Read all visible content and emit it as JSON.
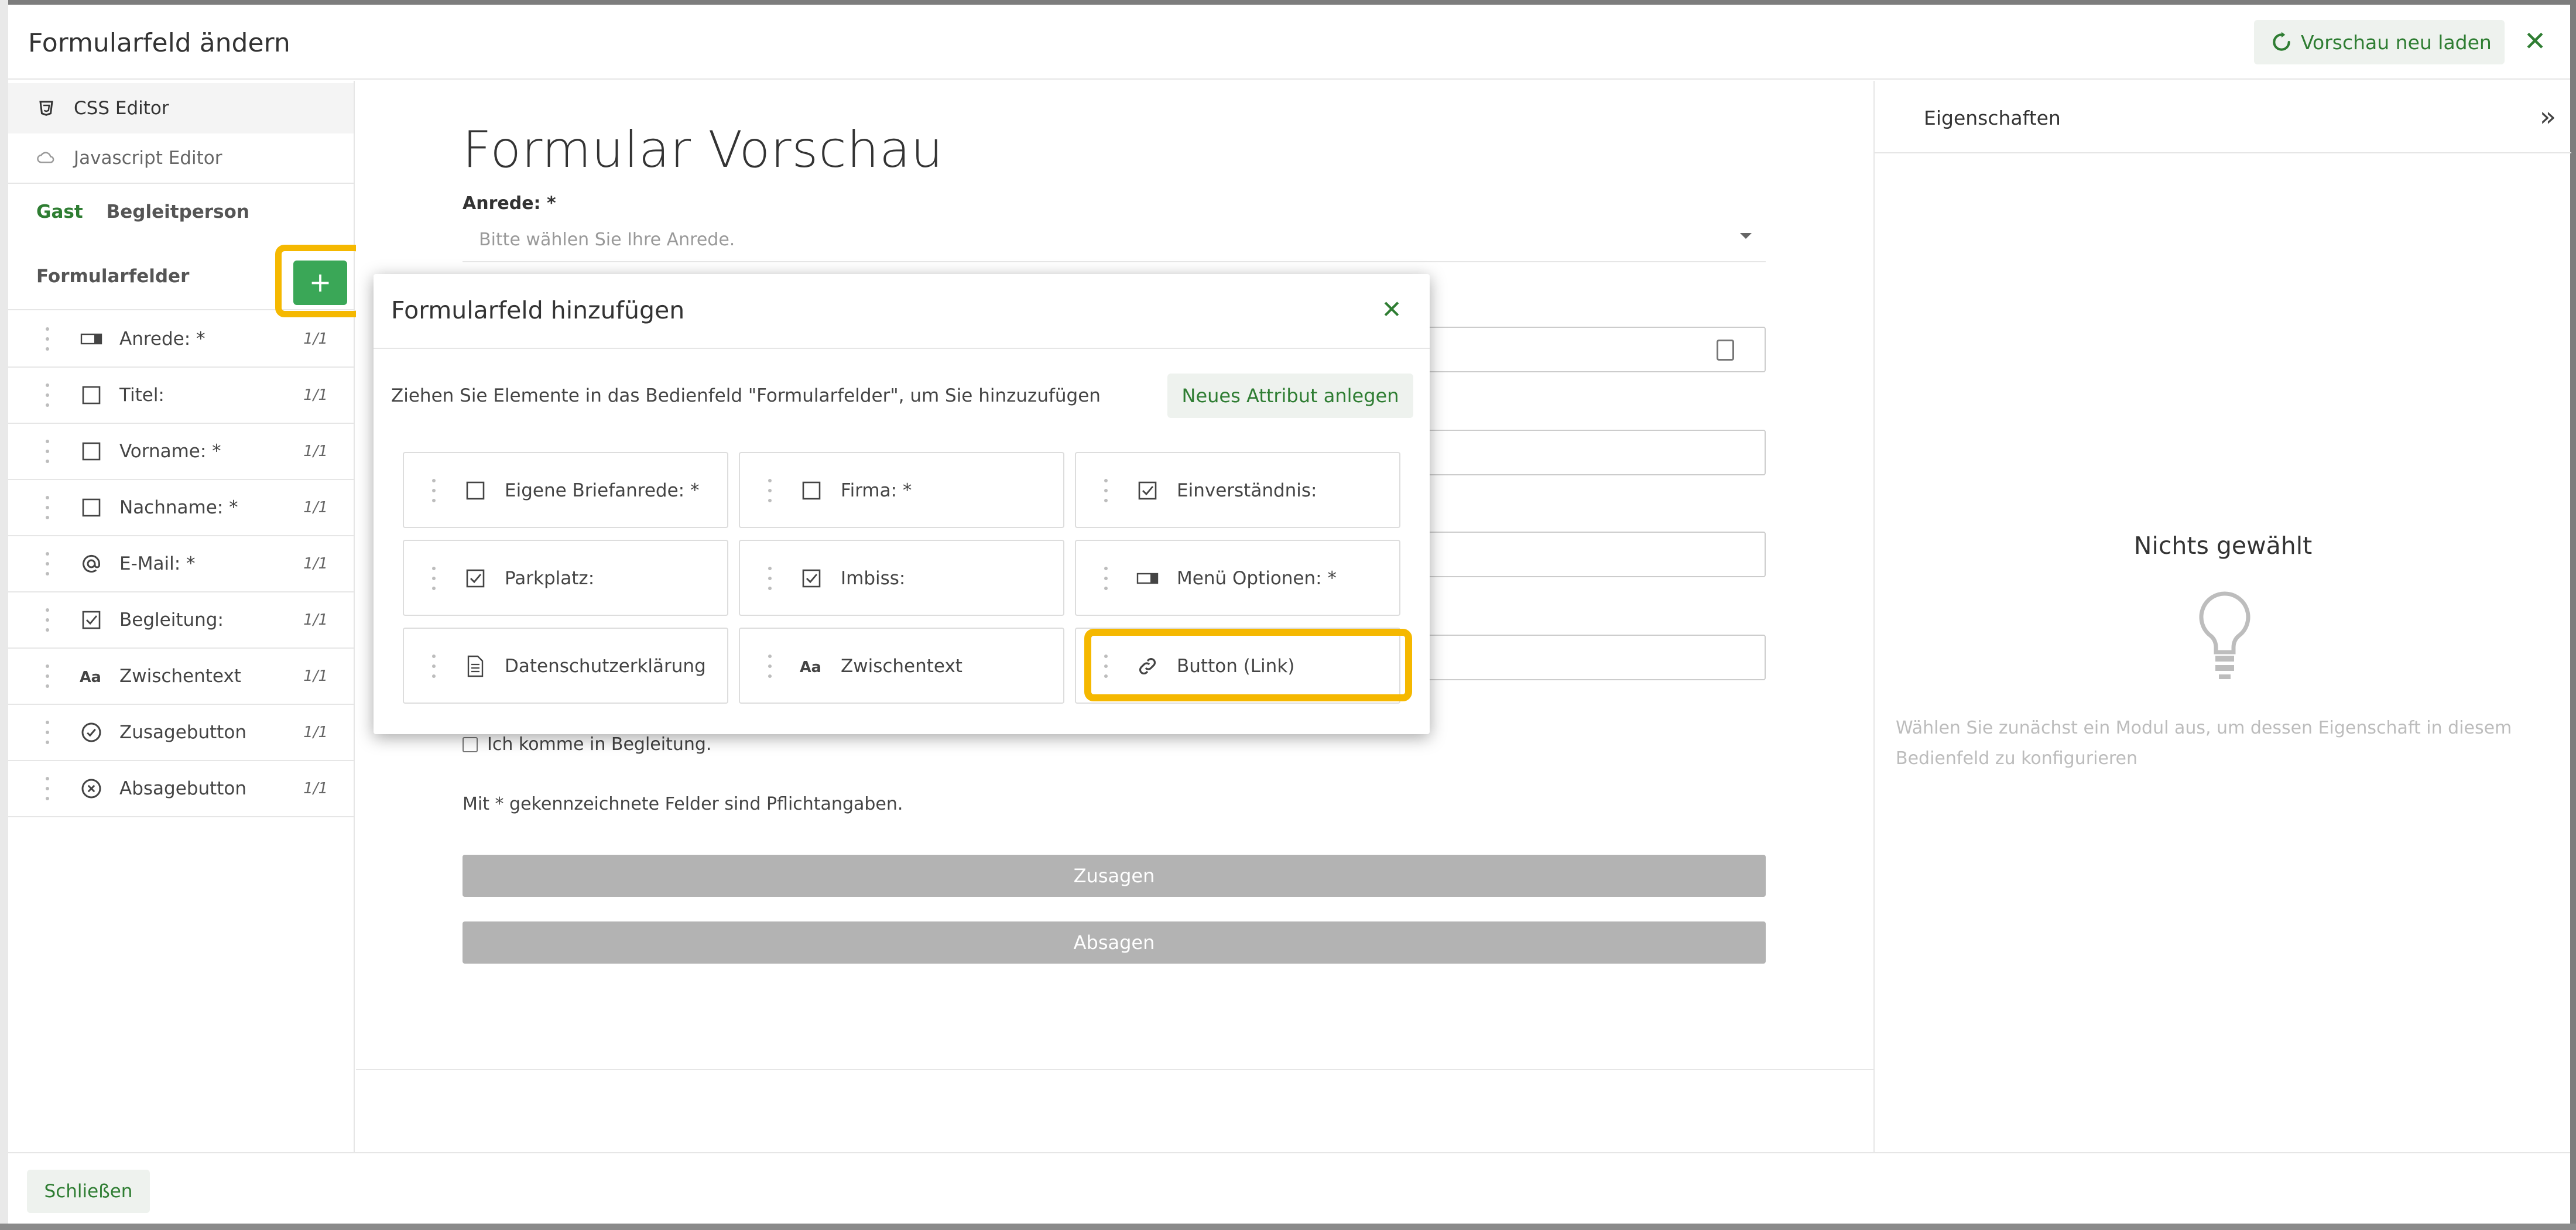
{
  "window": {
    "title": "Formularfeld ändern",
    "reload_label": "Vorschau neu laden",
    "close_symbol": "✕"
  },
  "sidebar": {
    "css_editor": "CSS Editor",
    "js_editor": "Javascript Editor",
    "tabs": [
      {
        "label": "Gast",
        "active": true
      },
      {
        "label": "Begleitperson",
        "active": false
      }
    ],
    "fields_label": "Formularfelder",
    "add_symbol": "+",
    "fields": [
      {
        "name": "Anrede: *",
        "count": "1/1",
        "icon": "select-icon"
      },
      {
        "name": "Titel:",
        "count": "1/1",
        "icon": "textbox-icon"
      },
      {
        "name": "Vorname: *",
        "count": "1/1",
        "icon": "textbox-icon"
      },
      {
        "name": "Nachname: *",
        "count": "1/1",
        "icon": "textbox-icon"
      },
      {
        "name": "E-Mail: *",
        "count": "1/1",
        "icon": "at-icon"
      },
      {
        "name": "Begleitung:",
        "count": "1/1",
        "icon": "checkbox-icon"
      },
      {
        "name": "Zwischentext",
        "count": "1/1",
        "icon": "text-icon"
      },
      {
        "name": "Zusagebutton",
        "count": "1/1",
        "icon": "check-circle-icon"
      },
      {
        "name": "Absagebutton",
        "count": "1/1",
        "icon": "x-circle-icon"
      }
    ]
  },
  "preview": {
    "title": "Formular Vorschau",
    "anrede_label": "Anrede: *",
    "anrede_placeholder": "Bitte wählen Sie Ihre Anrede.",
    "companion_checkbox": "Ich komme in Begleitung.",
    "required_note": "Mit * gekennzeichnete Felder sind Pflichtangaben.",
    "accept_button": "Zusagen",
    "decline_button": "Absagen"
  },
  "properties": {
    "title": "Eigenschaften",
    "collapse_symbol": "»",
    "empty_title": "Nichts gewählt",
    "hint": "Wählen Sie zunächst ein Modul aus, um dessen Eigenschaft in diesem Bedienfeld zu konfigurieren"
  },
  "footer": {
    "close_label": "Schließen"
  },
  "dialog": {
    "title": "Formularfeld hinzufügen",
    "close_symbol": "✕",
    "instruction": "Ziehen Sie Elemente in das Bedienfeld \"Formularfelder\", um Sie hinzuzufügen",
    "new_attribute": "Neues Attribut anlegen",
    "tiles": [
      {
        "name": "Eigene Briefanrede: *",
        "icon": "textbox-icon"
      },
      {
        "name": "Firma: *",
        "icon": "textbox-icon"
      },
      {
        "name": "Einverständnis:",
        "icon": "checkbox-icon"
      },
      {
        "name": "Parkplatz:",
        "icon": "checkbox-icon"
      },
      {
        "name": "Imbiss:",
        "icon": "checkbox-icon"
      },
      {
        "name": "Menü Optionen: *",
        "icon": "select-icon"
      },
      {
        "name": "Datenschutzerklärung",
        "icon": "document-icon"
      },
      {
        "name": "Zwischentext",
        "icon": "text-icon"
      },
      {
        "name": "Button (Link)",
        "icon": "link-icon"
      }
    ]
  },
  "colors": {
    "accent_green": "#2e7d32",
    "add_button_green": "#3aa757",
    "highlight_yellow": "#f5b800",
    "disabled_button": "#b3b3b3"
  }
}
